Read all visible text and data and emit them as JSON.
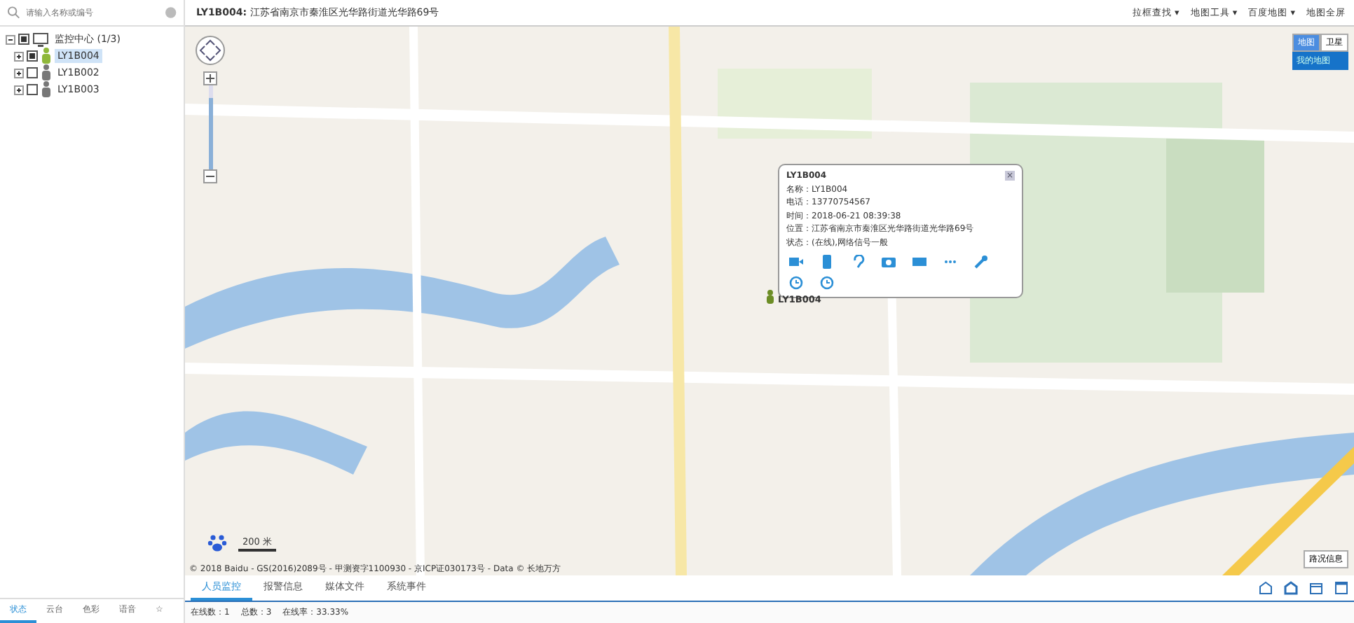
{
  "search": {
    "placeholder": "请输入名称或编号"
  },
  "tree": [
    {
      "label": "监控中心",
      "count": "(1/3)",
      "expanded": true,
      "checked": true,
      "kind": "group",
      "children": [
        {
          "label": "LY1B004",
          "expanded": false,
          "checked": true,
          "selected": true,
          "online": true,
          "kind": "device"
        },
        {
          "label": "LY1B002",
          "expanded": false,
          "checked": false,
          "selected": false,
          "online": false,
          "kind": "device"
        },
        {
          "label": "LY1B003",
          "expanded": false,
          "checked": false,
          "selected": false,
          "online": false,
          "kind": "device"
        }
      ]
    }
  ],
  "left_tabs": [
    {
      "label": "状态",
      "selected": true
    },
    {
      "label": "云台",
      "selected": false
    },
    {
      "label": "色彩",
      "selected": false
    },
    {
      "label": "语音",
      "selected": false
    },
    {
      "label": "☆",
      "selected": false
    }
  ],
  "header": {
    "id": "LY1B004:",
    "address": "江苏省南京市秦淮区光华路街道光华路69号"
  },
  "toolbar": [
    "拉框查找 ▾",
    "地图工具 ▾",
    "百度地图 ▾",
    "地图全屏"
  ],
  "map": {
    "zoom": {
      "level": 0.85
    },
    "types": [
      {
        "label": "地图",
        "selected": true
      },
      {
        "label": "卫星",
        "selected": false
      }
    ],
    "my_map": "我的地图",
    "popup": {
      "title": "LY1B004",
      "close": "×",
      "fields": [
        {
          "label": "名称：",
          "value": "LY1B004"
        },
        {
          "label": "电话：",
          "value": "13770754567"
        },
        {
          "label": "时间：",
          "value": "2018-06-21 08:39:38"
        },
        {
          "label": "位置：",
          "value": "江苏省南京市秦淮区光华路街道光华路69号"
        },
        {
          "label": "状态：",
          "value": "(在线),网络信号一般"
        }
      ]
    },
    "marker_label": "LY1B004",
    "scale": "200 米",
    "copyright": "© 2018 Baidu - GS(2016)2089号 - 甲测资字1100930 - 京ICP证030173号 - Data © 长地万方",
    "traffic": "路况信息"
  },
  "bottom_tabs": [
    {
      "label": "人员监控",
      "selected": true
    },
    {
      "label": "报警信息",
      "selected": false
    },
    {
      "label": "媒体文件",
      "selected": false
    },
    {
      "label": "系统事件",
      "selected": false
    }
  ],
  "status": [
    {
      "label": "在线数：",
      "value": "1"
    },
    {
      "label": "总数：",
      "value": "3"
    },
    {
      "label": "在线率：",
      "value": "33.33%"
    }
  ]
}
